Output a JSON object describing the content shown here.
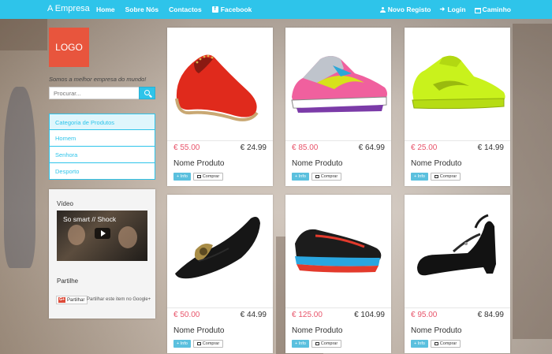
{
  "navbar": {
    "brand": "A Empresa",
    "left_links": [
      "Home",
      "Sobre Nós",
      "Contactos",
      "Facebook"
    ],
    "right_links": [
      "Novo Registo",
      "Login",
      "Caminho"
    ]
  },
  "sidebar": {
    "logo": "LOGO",
    "slogan": "Somos a melhor empresa do mundo!",
    "search_placeholder": "Procurar...",
    "categories_header": "Categoria de Produtos",
    "categories": [
      "Homem",
      "Senhora",
      "Desporto"
    ],
    "video_title": "Vídeo",
    "video_caption": "So smart // Shock",
    "share_title": "Partilhe",
    "share_button": "Partilhar",
    "share_text": "Partilhar este item no Google+"
  },
  "products": [
    {
      "old_price": "€ 55.00",
      "price": "€ 24.99",
      "name": "Nome Produto",
      "info": "+ Info",
      "buy": "Comprar"
    },
    {
      "old_price": "€ 85.00",
      "price": "€ 64.99",
      "name": "Nome Produto",
      "info": "+ Info",
      "buy": "Comprar"
    },
    {
      "old_price": "€ 25.00",
      "price": "€ 14.99",
      "name": "Nome Produto",
      "info": "+ Info",
      "buy": "Comprar"
    },
    {
      "old_price": "€ 50.00",
      "price": "€ 44.99",
      "name": "Nome Produto",
      "info": "+ Info",
      "buy": "Comprar"
    },
    {
      "old_price": "€ 125.00",
      "price": "€ 104.99",
      "name": "Nome Produto",
      "info": "+ Info",
      "buy": "Comprar"
    },
    {
      "old_price": "€ 95.00",
      "price": "€ 84.99",
      "name": "Nome Produto",
      "info": "+ Info",
      "buy": "Comprar"
    }
  ],
  "colors": {
    "navbar": "#2ec4ea",
    "logo": "#e8553d",
    "old_price": "#e8556b",
    "info_button": "#5bc0de"
  }
}
